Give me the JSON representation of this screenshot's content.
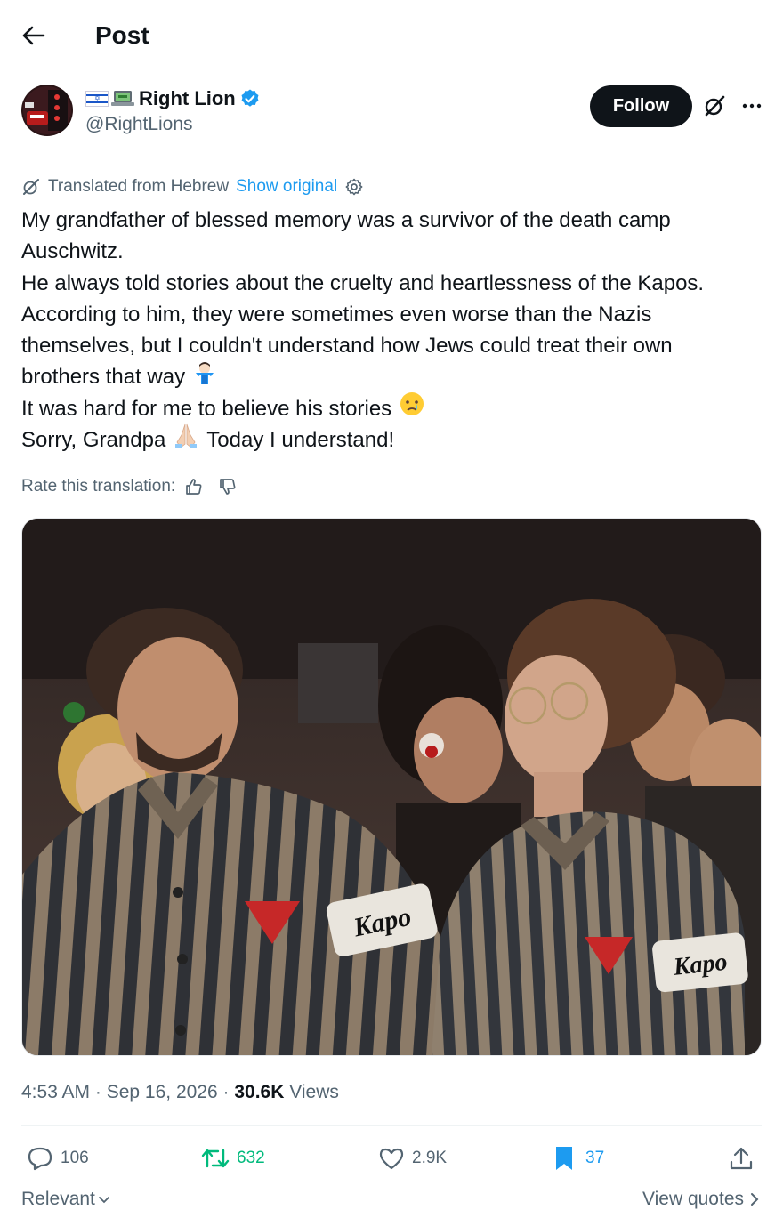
{
  "header": {
    "title": "Post"
  },
  "author": {
    "display_name": "Right Lion",
    "handle": "@RightLions",
    "verified": true
  },
  "actions_top": {
    "follow_label": "Follow"
  },
  "translation": {
    "translated_from": "Translated from Hebrew",
    "show_original": "Show original",
    "rate_label": "Rate this translation:"
  },
  "post": {
    "lines": [
      "My grandfather of blessed memory was a survivor of the death camp",
      "Auschwitz.",
      "He always told stories about the cruelty and heartlessness of the Kapos.",
      "According to him, they were sometimes even worse than the Nazis",
      "themselves, but I couldn't understand how Jews could treat their own",
      "brothers that way",
      "It was hard for me to believe his stories",
      "Sorry, Grandpa",
      "Today I understand!"
    ]
  },
  "media": {
    "armband_left": "Kapo",
    "armband_right": "Kapo"
  },
  "meta": {
    "time": "4:53 AM",
    "sep1": " · ",
    "date": "Sep 16, 2026",
    "sep2": " · ",
    "views_count": "30.6K",
    "views_label": " Views"
  },
  "stats": {
    "replies": "106",
    "reposts": "632",
    "likes": "2.9K",
    "bookmarks": "37"
  },
  "colors": {
    "text": "#0f1419",
    "secondary": "#536471",
    "link": "#1d9bf0",
    "repost_active": "#00ba7c",
    "bookmark_active": "#1d9bf0"
  },
  "footer": {
    "relevant": "Relevant",
    "view_quotes": "View quotes"
  }
}
